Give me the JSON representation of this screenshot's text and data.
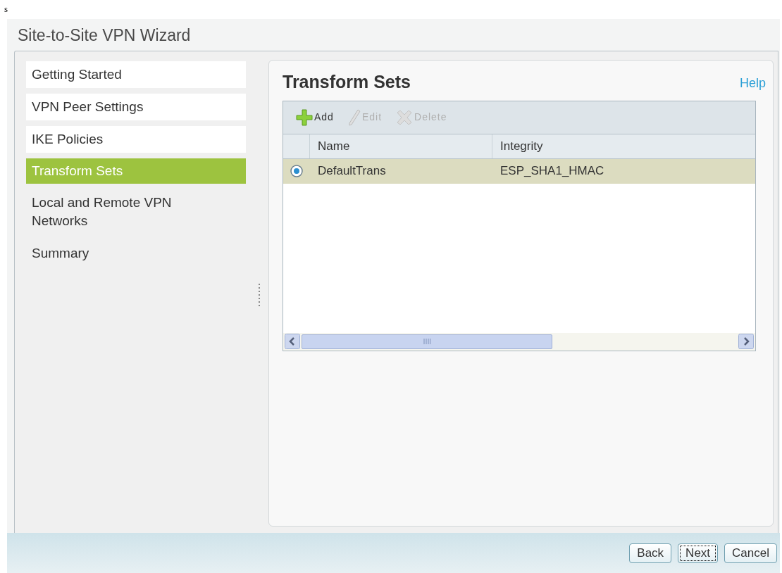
{
  "stray_text": "s",
  "window": {
    "title": "Site-to-Site VPN Wizard"
  },
  "steps": [
    {
      "label": "Getting Started",
      "selected": false
    },
    {
      "label": "VPN Peer Settings",
      "selected": false
    },
    {
      "label": "IKE Policies",
      "selected": false
    },
    {
      "label": "Transform Sets",
      "selected": true
    },
    {
      "label": "Local and Remote VPN Networks",
      "selected": false
    },
    {
      "label": "Summary",
      "selected": false
    }
  ],
  "panel": {
    "title": "Transform Sets",
    "help": "Help"
  },
  "toolbar": [
    {
      "kind": "add",
      "label": "Add",
      "disabled": false
    },
    {
      "kind": "edit",
      "label": "Edit",
      "disabled": true
    },
    {
      "kind": "delete",
      "label": "Delete",
      "disabled": true
    }
  ],
  "table": {
    "columns": [
      "Name",
      "Integrity"
    ],
    "rows": [
      {
        "cells": [
          "DefaultTrans",
          "ESP_SHA1_HMAC"
        ],
        "selected": true
      }
    ]
  },
  "buttons": [
    {
      "label": "Back",
      "focused": false
    },
    {
      "label": "Next",
      "focused": true
    },
    {
      "label": "Cancel",
      "focused": false
    }
  ]
}
